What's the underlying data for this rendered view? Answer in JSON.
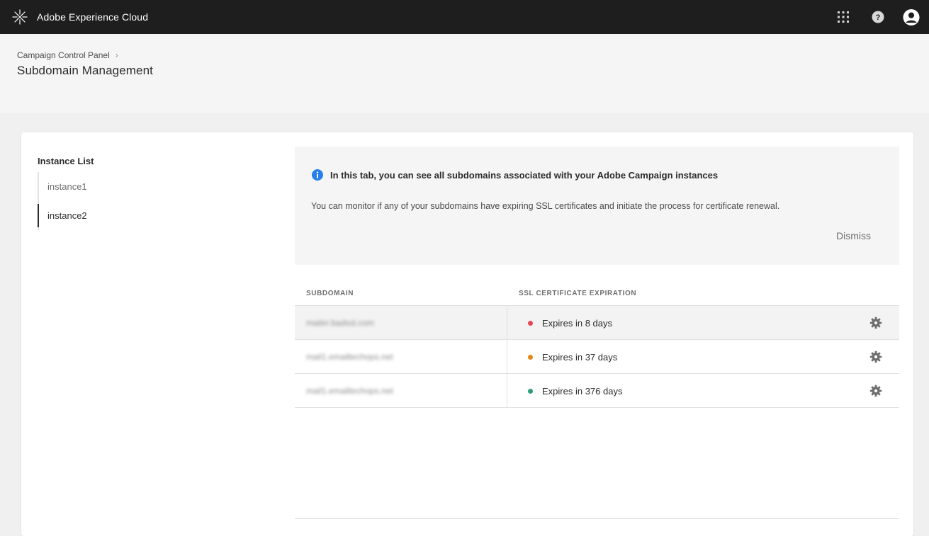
{
  "topbar": {
    "brand": "Adobe Experience Cloud",
    "icons": [
      "apps-grid-icon",
      "help-icon",
      "user-profile-icon"
    ]
  },
  "header": {
    "breadcrumb": "Campaign Control Panel",
    "title": "Subdomain Management"
  },
  "sidebar": {
    "title": "Instance List",
    "items": [
      {
        "label": "instance1",
        "active": false
      },
      {
        "label": "instance2",
        "active": true
      }
    ]
  },
  "info": {
    "title": "In this tab, you can see all subdomains associated with your Adobe Campaign instances",
    "description": "You can monitor if any of your subdomains have expiring SSL certificates and initiate the process for certificate renewal.",
    "dismiss": "Dismiss"
  },
  "table": {
    "columns": [
      "SUBDOMAIN",
      "SSL CERTIFICATE EXPIRATION"
    ],
    "rows": [
      {
        "subdomain": "mailer.badssl.com",
        "expiration": "Expires in 8 days",
        "status_color": "#e34850",
        "selected": true
      },
      {
        "subdomain": "mail1.emailtechops.net",
        "expiration": "Expires in 37 days",
        "status_color": "#e68619",
        "selected": false
      },
      {
        "subdomain": "mail1.emailtechops.net",
        "expiration": "Expires in 376 days",
        "status_color": "#2d9d78",
        "selected": false
      }
    ]
  },
  "colors": {
    "topbar": "#1e1e1e",
    "info_icon": "#2680eb",
    "status_red": "#e34850",
    "status_orange": "#e68619",
    "status_green": "#2d9d78"
  }
}
